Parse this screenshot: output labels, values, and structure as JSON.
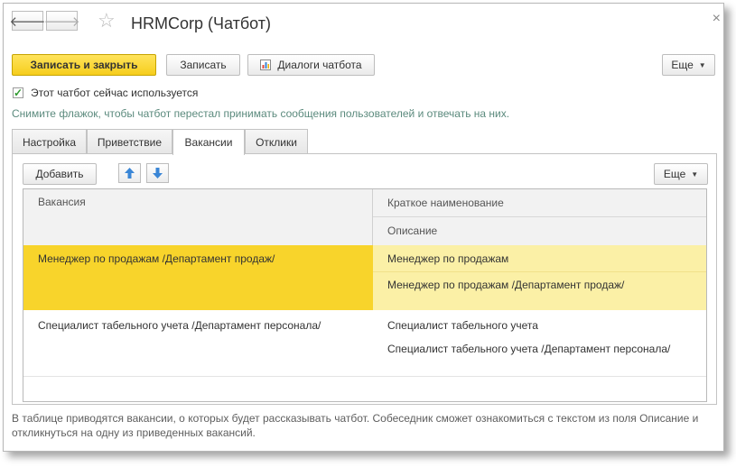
{
  "window": {
    "title": "HRMCorp (Чатбот)",
    "back_glyph": "🡐",
    "forward_glyph": "🡒",
    "star_glyph": "☆",
    "close_glyph": "×"
  },
  "toolbar": {
    "save_close_label": "Записать и закрыть",
    "save_label": "Записать",
    "dialogs_label": "Диалоги чатбота",
    "more_label": "Еще"
  },
  "active_checkbox": {
    "checked": true,
    "label": "Этот чатбот сейчас используется",
    "hint": "Снимите флажок, чтобы чатбот перестал принимать сообщения пользователей и отвечать на них."
  },
  "tabs": [
    {
      "label": "Настройка"
    },
    {
      "label": "Приветствие"
    },
    {
      "label": "Вакансии",
      "active": true
    },
    {
      "label": "Отклики"
    }
  ],
  "vacancies": {
    "add_label": "Добавить",
    "more_label": "Еще",
    "columns": {
      "vacancy": "Вакансия",
      "short_name": "Краткое наименование",
      "description": "Описание"
    },
    "rows": [
      {
        "vacancy": "Менеджер по продажам /Департамент продаж/",
        "short_name": "Менеджер по продажам",
        "description": "Менеджер по продажам /Департамент продаж/",
        "selected": true
      },
      {
        "vacancy": "Специалист табельного учета /Департамент персонала/",
        "short_name": "Специалист табельного учета",
        "description": "Специалист табельного учета /Департамент персонала/",
        "selected": false
      }
    ],
    "note": "В таблице приводятся вакансии, о которых будет рассказывать чатбот. Собеседник сможет ознакомиться с текстом из поля Описание и откликнуться на одну из приведенных вакансий."
  },
  "colors": {
    "accent_yellow": "#f8d42b",
    "selected_light": "#fbf0a6",
    "hint_green": "#5b8a7d",
    "check_green": "#2f9a2f",
    "arrow_blue": "#3a86d6"
  }
}
